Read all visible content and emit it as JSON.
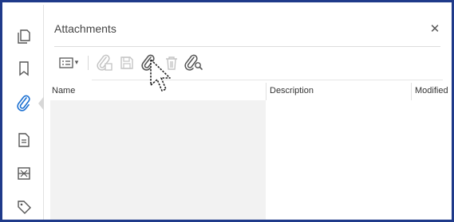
{
  "rail": {
    "items": [
      {
        "icon": "pages-icon"
      },
      {
        "icon": "bookmark-icon"
      },
      {
        "icon": "attachment-icon",
        "active": true
      },
      {
        "icon": "page-thumbnail-icon"
      },
      {
        "icon": "layers-icon"
      },
      {
        "icon": "tag-icon"
      }
    ],
    "active_color": "#1a6fd1"
  },
  "panel": {
    "title": "Attachments",
    "close_glyph": "✕"
  },
  "toolbar": {
    "options_caret": "▾",
    "buttons": [
      {
        "icon": "options-icon"
      },
      {
        "icon": "open-attachment-icon",
        "enabled": false
      },
      {
        "icon": "save-attachment-icon",
        "enabled": false
      },
      {
        "icon": "add-attachment-icon",
        "enabled": true
      },
      {
        "icon": "delete-attachment-icon",
        "enabled": false
      },
      {
        "icon": "search-attachment-icon",
        "enabled": true
      }
    ]
  },
  "table": {
    "columns": [
      "Name",
      "Description",
      "Modified"
    ],
    "rows": []
  }
}
